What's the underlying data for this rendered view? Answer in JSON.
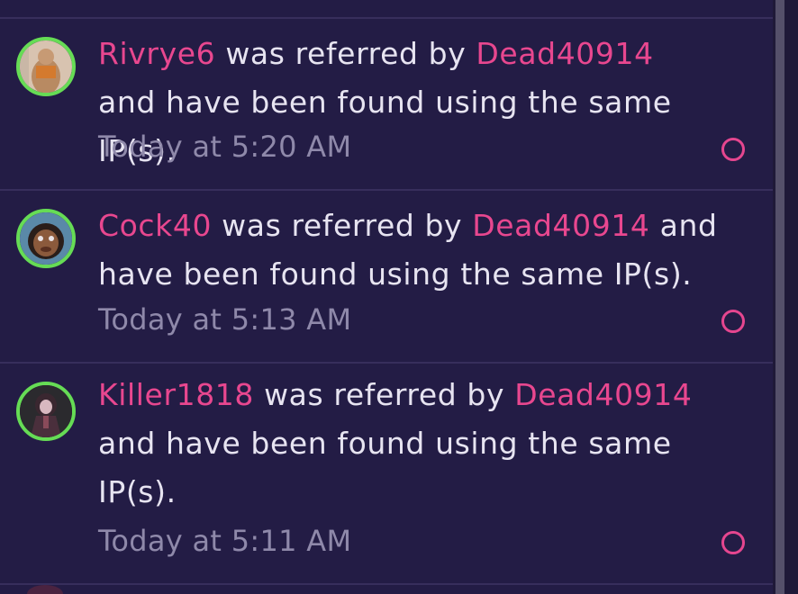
{
  "colors": {
    "background": "#231c45",
    "username": "#e8478f",
    "text": "#e7e4f1",
    "timestamp": "#8f89aa",
    "avatar_ring": "#66dc55",
    "unread_dot": "#e5468f"
  },
  "notifications": [
    {
      "user": "Rivrye6",
      "referrer": "Dead40914",
      "text_mid": " was referred by ",
      "text_end": " and have been found using the same IP(s).",
      "time": "Today at 5:20 AM",
      "avatar_icon": "user-avatar-icon",
      "unread_icon": "unread-circle-icon"
    },
    {
      "user": "Cock40",
      "referrer": "Dead40914",
      "text_mid": " was referred by ",
      "text_end": " and have been found using the same IP(s).",
      "time": "Today at 5:13 AM",
      "avatar_icon": "user-avatar-icon",
      "unread_icon": "unread-circle-icon"
    },
    {
      "user": "Killer1818",
      "referrer": "Dead40914",
      "text_mid": " was referred by ",
      "text_end": " and have been found using the same IP(s).",
      "time": "Today at 5:11 AM",
      "avatar_icon": "user-avatar-icon",
      "unread_icon": "unread-circle-icon"
    }
  ]
}
